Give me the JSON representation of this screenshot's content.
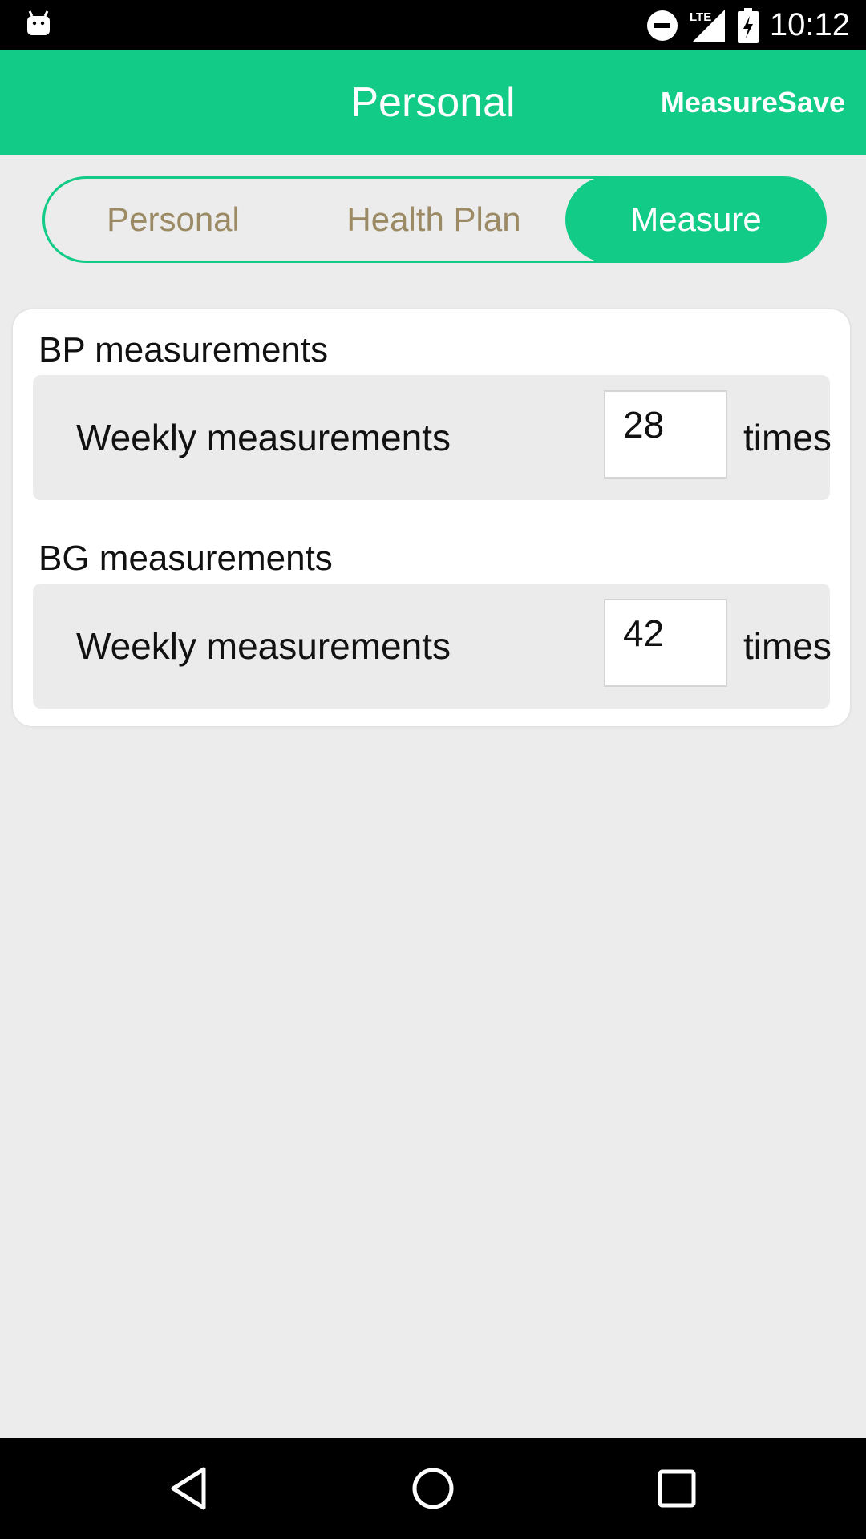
{
  "status_bar": {
    "time": "10:12",
    "network": "LTE",
    "icons": [
      "android-icon",
      "do-not-disturb-icon",
      "signal-icon",
      "battery-charging-icon"
    ]
  },
  "app_bar": {
    "title": "Personal",
    "action_label": "MeasureSave"
  },
  "tabs": [
    {
      "label": "Personal",
      "active": false
    },
    {
      "label": "Health Plan",
      "active": false
    },
    {
      "label": "Measure",
      "active": true
    }
  ],
  "sections": [
    {
      "title": "BP measurements",
      "row_label": "Weekly measurements",
      "value": "28",
      "unit": "times"
    },
    {
      "title": "BG measurements",
      "row_label": "Weekly measurements",
      "value": "42",
      "unit": "times"
    }
  ],
  "nav_bar": {
    "icons": [
      "back-icon",
      "home-icon",
      "recents-icon"
    ]
  },
  "colors": {
    "accent": "#11cb86",
    "tab_inactive_text": "#9b8a64",
    "background": "#ececec"
  }
}
